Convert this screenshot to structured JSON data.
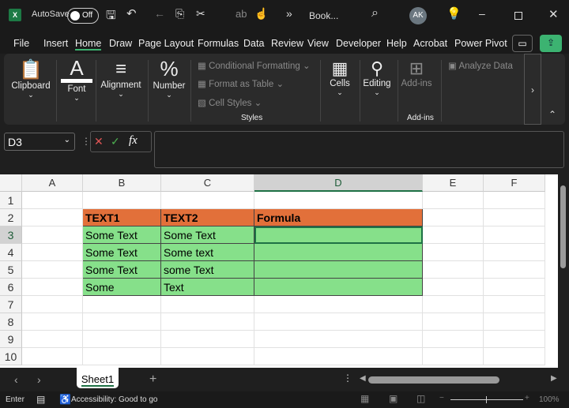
{
  "title_bar": {
    "autosave_label": "AutoSave",
    "autosave_state": "Off",
    "doc_title": "Book...",
    "avatar_initials": "AK"
  },
  "menu": [
    "File",
    "Insert",
    "Home",
    "Draw",
    "Page Layout",
    "Formulas",
    "Data",
    "Review",
    "View",
    "Developer",
    "Help",
    "Acrobat",
    "Power Pivot"
  ],
  "active_menu": "Home",
  "ribbon": {
    "clipboard": "Clipboard",
    "font": "Font",
    "alignment": "Alignment",
    "number": "Number",
    "conditional_formatting": "Conditional Formatting",
    "format_as_table": "Format as Table",
    "cell_styles": "Cell Styles",
    "styles_group": "Styles",
    "cells": "Cells",
    "editing": "Editing",
    "addins_button": "Add-ins",
    "addins_group": "Add-ins",
    "analyze_data": "Analyze Data"
  },
  "formula_bar": {
    "name_box": "D3",
    "fx_label": "fx",
    "value": ""
  },
  "columns": [
    "A",
    "B",
    "C",
    "D",
    "E",
    "F"
  ],
  "rows": [
    "1",
    "2",
    "3",
    "4",
    "5",
    "6",
    "7",
    "8",
    "9",
    "10"
  ],
  "cells": {
    "header": [
      "TEXT1",
      "TEXT2",
      "Formula"
    ],
    "data": [
      [
        "Some Text",
        "Some Text",
        ""
      ],
      [
        "Some Text",
        "Some text",
        ""
      ],
      [
        "Some Text",
        "some Text",
        ""
      ],
      [
        "Some",
        "Text",
        ""
      ]
    ]
  },
  "colors": {
    "header_fill": "#E2703A",
    "data_fill": "#86E08A",
    "accent": "#3cb371"
  },
  "sheet_tabs": {
    "active": "Sheet1",
    "add": "+"
  },
  "status_bar": {
    "mode": "Enter",
    "accessibility": "Accessibility: Good to go",
    "zoom": "100%"
  }
}
